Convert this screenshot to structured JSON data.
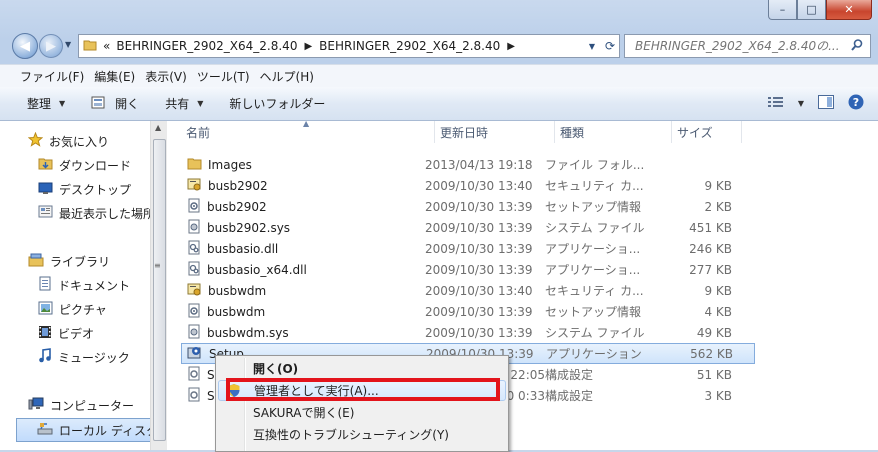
{
  "window": {
    "caption_buttons": [
      "–",
      "□",
      "✕"
    ]
  },
  "address": {
    "overflow": "«",
    "crumbs": [
      "BEHRINGER_2902_X64_2.8.40",
      "BEHRINGER_2902_X64_2.8.40"
    ],
    "search_placeholder": "BEHRINGER_2902_X64_2.8.40の..."
  },
  "menubar": [
    "ファイル(F)",
    "編集(E)",
    "表示(V)",
    "ツール(T)",
    "ヘルプ(H)"
  ],
  "commands": {
    "organize": "整理",
    "open": "開く",
    "share": "共有",
    "new_folder": "新しいフォルダー"
  },
  "nav": {
    "favorites": "お気に入り",
    "downloads": "ダウンロード",
    "desktop": "デスクトップ",
    "recent": "最近表示した場所",
    "libraries": "ライブラリ",
    "documents": "ドキュメント",
    "pictures": "ピクチャ",
    "videos": "ビデオ",
    "music": "ミュージック",
    "computer": "コンピューター",
    "local_disk": "ローカル ディスク"
  },
  "columns": {
    "name": "名前",
    "date": "更新日時",
    "type": "種類",
    "size": "サイズ"
  },
  "files": [
    {
      "name": "Images",
      "date": "2013/04/13 19:18",
      "type": "ファイル フォル...",
      "size": "",
      "icon": "folder-icon"
    },
    {
      "name": "busb2902",
      "date": "2009/10/30 13:40",
      "type": "セキュリティ カ...",
      "size": "9 KB",
      "icon": "certificate-icon"
    },
    {
      "name": "busb2902",
      "date": "2009/10/30 13:39",
      "type": "セットアップ情報",
      "size": "2 KB",
      "icon": "setup-info-icon"
    },
    {
      "name": "busb2902.sys",
      "date": "2009/10/30 13:39",
      "type": "システム ファイル",
      "size": "451 KB",
      "icon": "system-file-icon"
    },
    {
      "name": "busbasio.dll",
      "date": "2009/10/30 13:39",
      "type": "アプリケーショ...",
      "size": "246 KB",
      "icon": "dll-icon"
    },
    {
      "name": "busbasio_x64.dll",
      "date": "2009/10/30 13:39",
      "type": "アプリケーショ...",
      "size": "277 KB",
      "icon": "dll-icon"
    },
    {
      "name": "busbwdm",
      "date": "2009/10/30 13:40",
      "type": "セキュリティ カ...",
      "size": "9 KB",
      "icon": "certificate-icon"
    },
    {
      "name": "busbwdm",
      "date": "2009/10/30 13:39",
      "type": "セットアップ情報",
      "size": "4 KB",
      "icon": "setup-info-icon"
    },
    {
      "name": "busbwdm.sys",
      "date": "2009/10/30 13:39",
      "type": "システム ファイル",
      "size": "49 KB",
      "icon": "system-file-icon"
    },
    {
      "name": "Setup",
      "date": "2009/10/30 13:39",
      "type": "アプリケーション",
      "size": "562 KB",
      "icon": "setup-exe-icon"
    },
    {
      "name": "S",
      "date": "1 22:05",
      "type": "構成設定",
      "size": "51 KB",
      "icon": "config-icon"
    },
    {
      "name": "S",
      "date": "0 0:33",
      "type": "構成設定",
      "size": "3 KB",
      "icon": "config-icon"
    }
  ],
  "context_menu": [
    "開く(O)",
    "管理者として実行(A)...",
    "SAKURAで開く(E)",
    "互換性のトラブルシューティング(Y)"
  ]
}
